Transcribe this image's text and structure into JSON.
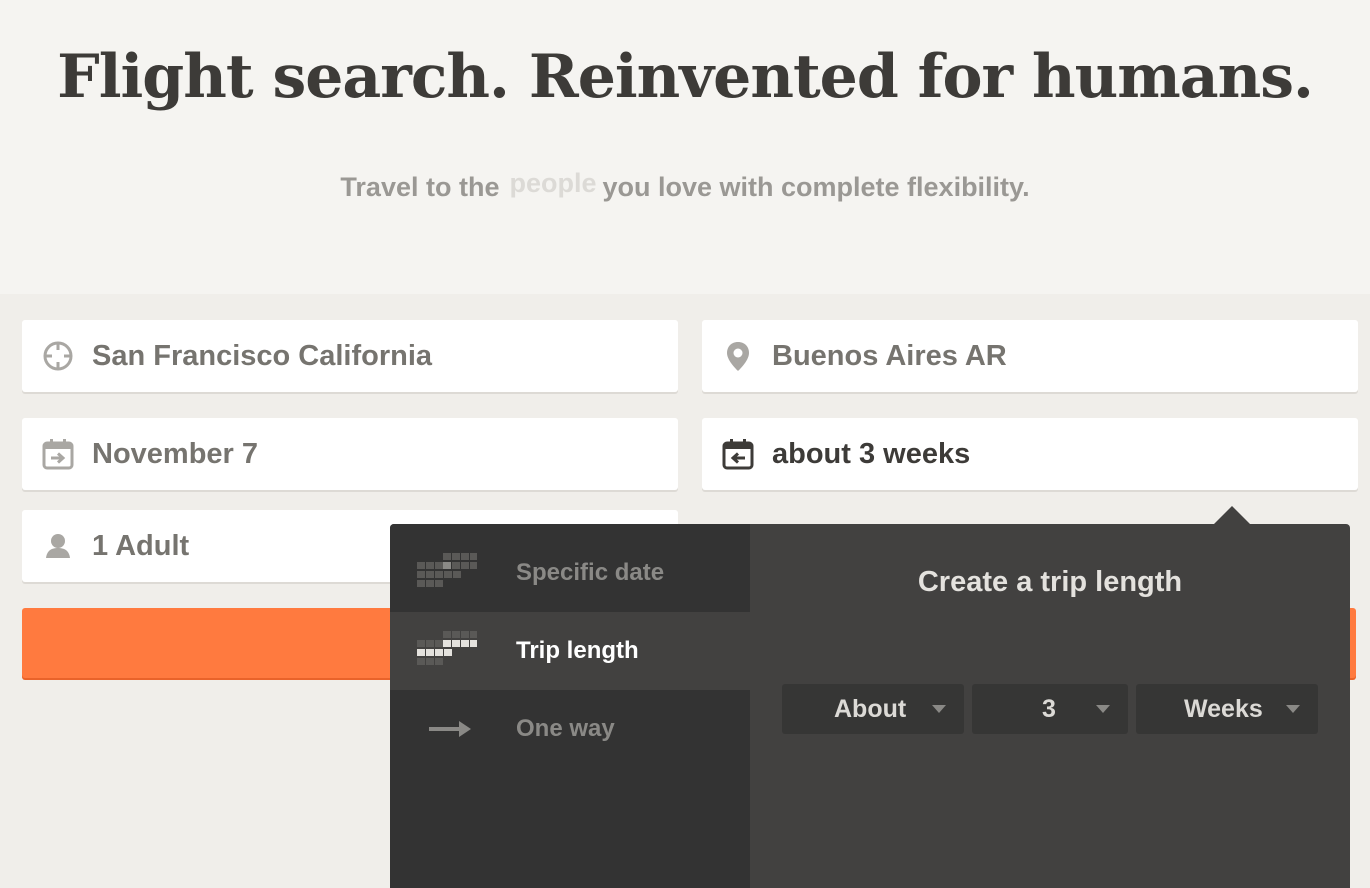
{
  "hero": {
    "headline": "Flight search. Reinvented for humans.",
    "tagline_prefix": "Travel to the",
    "tagline_rotating_word": "people",
    "tagline_suffix": "you love with complete flexibility."
  },
  "form": {
    "origin": {
      "value": "San Francisco California",
      "icon": "crosshair-icon"
    },
    "destination": {
      "value": "Buenos Aires AR",
      "icon": "map-pin-icon"
    },
    "depart_date": {
      "value": "November 7",
      "icon": "calendar-depart-icon"
    },
    "return_date": {
      "value": "about 3 weeks",
      "icon": "calendar-return-icon"
    },
    "passengers": {
      "value": "1 Adult",
      "icon": "person-icon"
    },
    "search_button_color": "#ff7a3f"
  },
  "date_popover": {
    "options": [
      {
        "label": "Specific date",
        "icon": "calendar-grid-icon",
        "selected": false
      },
      {
        "label": "Trip length",
        "icon": "calendar-range-icon",
        "selected": true
      },
      {
        "label": "One way",
        "icon": "arrow-right-icon",
        "selected": false
      }
    ],
    "title": "Create a trip length",
    "qualifier": "About",
    "amount": "3",
    "unit": "Weeks"
  },
  "colors": {
    "accent": "#ff7a3f",
    "popover_bg": "#424140",
    "menu_bg": "#333333"
  }
}
